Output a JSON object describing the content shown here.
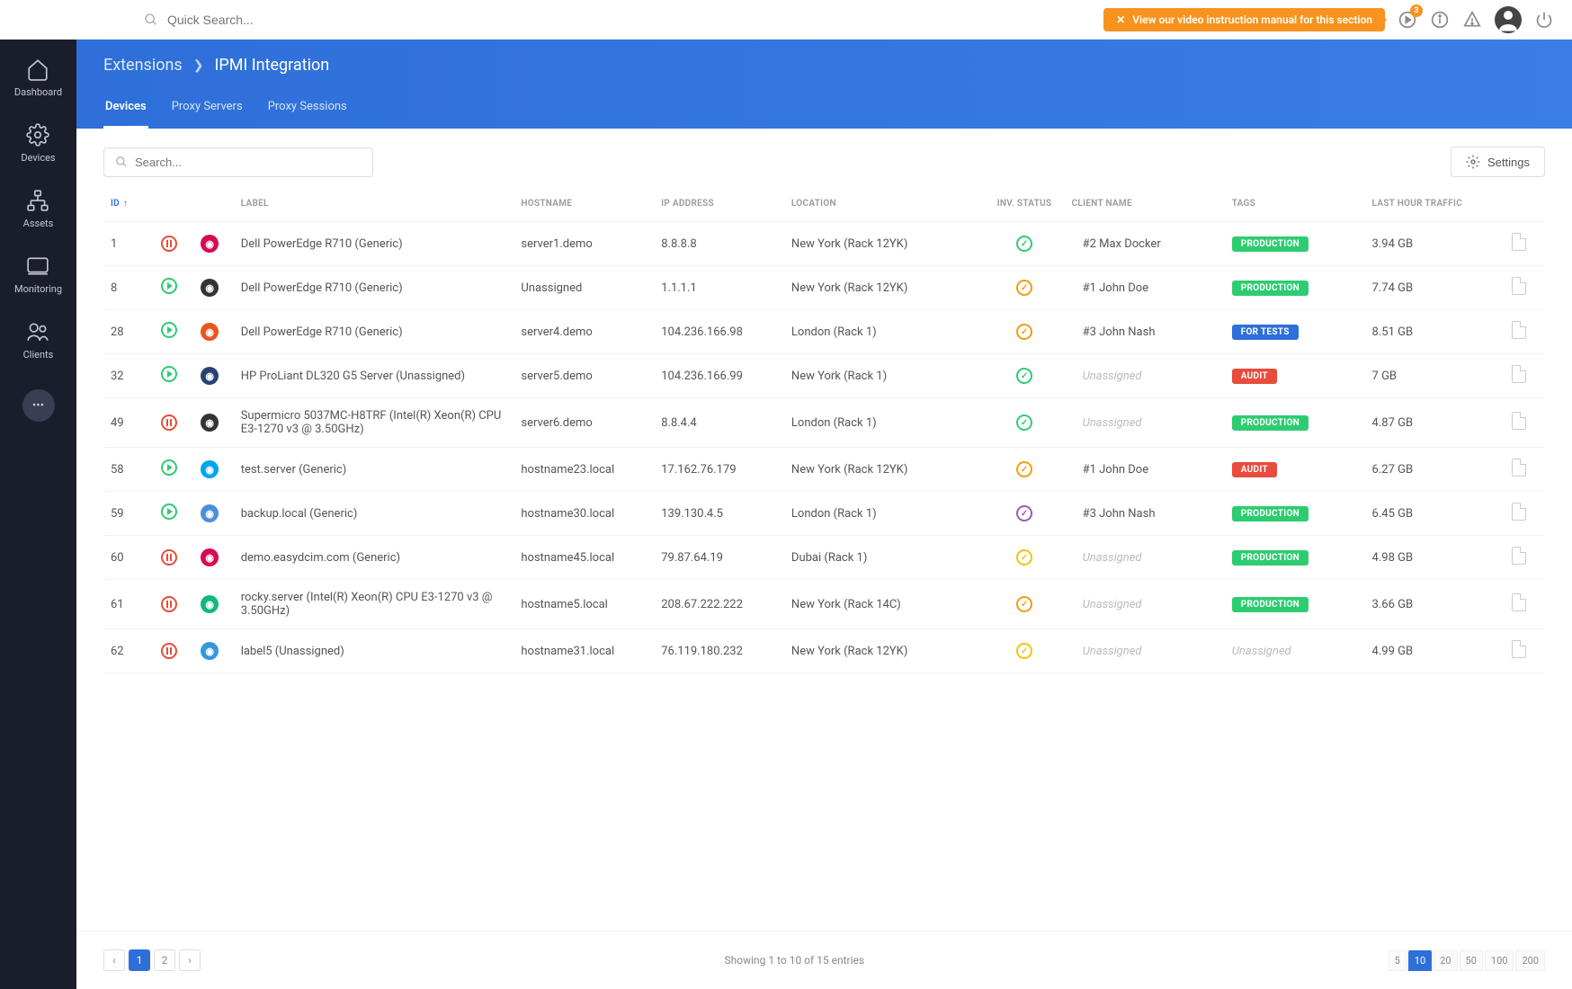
{
  "topbar": {
    "search_placeholder": "Quick Search...",
    "video_banner": "View our video instruction manual for this section",
    "badge": "3"
  },
  "sidebar": {
    "items": [
      {
        "label": "Dashboard"
      },
      {
        "label": "Devices"
      },
      {
        "label": "Assets"
      },
      {
        "label": "Monitoring"
      },
      {
        "label": "Clients"
      }
    ]
  },
  "breadcrumb": {
    "parent": "Extensions",
    "current": "IPMI Integration"
  },
  "tabs": [
    {
      "label": "Devices",
      "active": true
    },
    {
      "label": "Proxy Servers"
    },
    {
      "label": "Proxy Sessions"
    }
  ],
  "toolbar": {
    "search_placeholder": "Search...",
    "settings_label": "Settings"
  },
  "columns": [
    "ID",
    "",
    "",
    "LABEL",
    "HOSTNAME",
    "IP ADDRESS",
    "LOCATION",
    "INV. STATUS",
    "CLIENT NAME",
    "TAGS",
    "LAST HOUR TRAFFIC",
    ""
  ],
  "rows": [
    {
      "id": "1",
      "state": "pause",
      "os": "debian",
      "os_color": "#d70a53",
      "label": "Dell PowerEdge R710 (Generic)",
      "hostname": "server1.demo",
      "ip": "8.8.8.8",
      "location": "New York (Rack 12YK)",
      "inv": "green",
      "client": "#2 Max Docker",
      "tag": "PRODUCTION",
      "tag_color": "green",
      "traffic": "3.94 GB"
    },
    {
      "id": "8",
      "state": "play",
      "os": "linux",
      "os_color": "#333",
      "label": "Dell PowerEdge R710 (Generic)",
      "hostname": "Unassigned",
      "ip": "1.1.1.1",
      "location": "New York (Rack 12YK)",
      "inv": "orange",
      "client": "#1 John Doe",
      "tag": "PRODUCTION",
      "tag_color": "green",
      "traffic": "7.74 GB"
    },
    {
      "id": "28",
      "state": "play",
      "os": "ubuntu",
      "os_color": "#e95420",
      "label": "Dell PowerEdge R710 (Generic)",
      "hostname": "server4.demo",
      "ip": "104.236.166.98",
      "location": "London (Rack 1)",
      "inv": "orange",
      "client": "#3 John Nash",
      "tag": "FOR TESTS",
      "tag_color": "blue",
      "traffic": "8.51 GB"
    },
    {
      "id": "32",
      "state": "play",
      "os": "fedora",
      "os_color": "#294172",
      "label": "HP ProLiant DL320 G5 Server (Unassigned)",
      "hostname": "server5.demo",
      "ip": "104.236.166.99",
      "location": "New York (Rack 1)",
      "inv": "green",
      "client": "Unassigned",
      "client_unassigned": true,
      "tag": "AUDIT",
      "tag_color": "red",
      "traffic": "7 GB"
    },
    {
      "id": "49",
      "state": "pause",
      "os": "linux",
      "os_color": "#333",
      "label": "Supermicro 5037MC-H8TRF (Intel(R) Xeon(R) CPU E3-1270 v3 @ 3.50GHz)",
      "hostname": "server6.demo",
      "ip": "8.8.4.4",
      "location": "London (Rack 1)",
      "inv": "green",
      "client": "Unassigned",
      "client_unassigned": true,
      "tag": "PRODUCTION",
      "tag_color": "green",
      "traffic": "4.87 GB"
    },
    {
      "id": "58",
      "state": "play",
      "os": "windows",
      "os_color": "#00a4ef",
      "label": "test.server (Generic)",
      "hostname": "hostname23.local",
      "ip": "17.162.76.179",
      "location": "New York (Rack 12YK)",
      "inv": "orange",
      "client": "#1 John Doe",
      "tag": "AUDIT",
      "tag_color": "red",
      "traffic": "6.27 GB"
    },
    {
      "id": "59",
      "state": "play",
      "os": "slack",
      "os_color": "#4a90d9",
      "label": "backup.local (Generic)",
      "hostname": "hostname30.local",
      "ip": "139.130.4.5",
      "location": "London (Rack 1)",
      "inv": "purple",
      "client": "#3 John Nash",
      "tag": "PRODUCTION",
      "tag_color": "green",
      "traffic": "6.45 GB"
    },
    {
      "id": "60",
      "state": "pause",
      "os": "debian",
      "os_color": "#d70a53",
      "label": "demo.easydcim.com (Generic)",
      "hostname": "hostname45.local",
      "ip": "79.87.64.19",
      "location": "Dubai (Rack 1)",
      "inv": "yellow",
      "client": "Unassigned",
      "client_unassigned": true,
      "tag": "PRODUCTION",
      "tag_color": "green",
      "traffic": "4.98 GB"
    },
    {
      "id": "61",
      "state": "pause",
      "os": "rocky",
      "os_color": "#10b981",
      "label": "rocky.server (Intel(R) Xeon(R) CPU E3-1270 v3 @ 3.50GHz)",
      "hostname": "hostname5.local",
      "ip": "208.67.222.222",
      "location": "New York (Rack 14C)",
      "inv": "orange",
      "client": "Unassigned",
      "client_unassigned": true,
      "tag": "PRODUCTION",
      "tag_color": "green",
      "traffic": "3.66 GB"
    },
    {
      "id": "62",
      "state": "pause",
      "os": "unknown",
      "os_color": "#3498db",
      "label": "label5 (Unassigned)",
      "hostname": "hostname31.local",
      "ip": "76.119.180.232",
      "location": "New York (Rack 12YK)",
      "inv": "yellow",
      "client": "Unassigned",
      "client_unassigned": true,
      "tag": "Unassigned",
      "tag_unassigned": true,
      "traffic": "4.99 GB"
    }
  ],
  "footer": {
    "entries_text": "Showing 1 to 10 of 15 entries",
    "pages": [
      "1",
      "2"
    ],
    "active_page": "1",
    "sizes": [
      "5",
      "10",
      "20",
      "50",
      "100",
      "200"
    ],
    "active_size": "10"
  }
}
